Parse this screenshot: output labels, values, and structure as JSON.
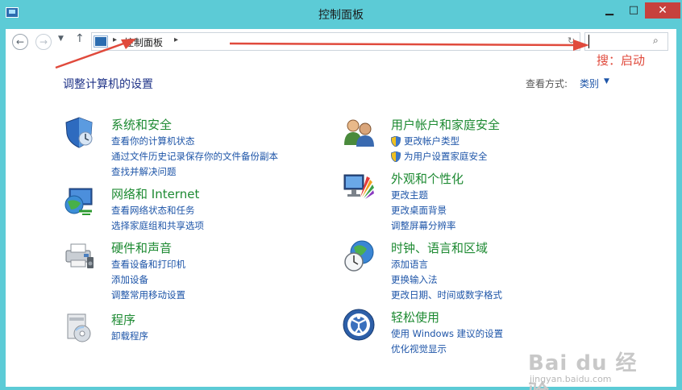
{
  "window": {
    "title": "控制面板",
    "minimize_glyph": "▁",
    "maximize_glyph": "□",
    "close_glyph": "✕"
  },
  "navbar": {
    "back_glyph": "←",
    "forward_glyph": "→",
    "dropdown_glyph": "▼",
    "up_glyph": "↑",
    "breadcrumb_sep": "▸",
    "breadcrumb": "控制面板",
    "refresh_glyph": "↻",
    "search_value": "",
    "search_glyph": "⌕"
  },
  "annotation": {
    "search_note": "搜：启动",
    "color": "#e04a3c"
  },
  "main": {
    "heading": "调整计算机的设置",
    "view_by_label": "查看方式:",
    "view_by_value": "类别",
    "view_by_caret": "▼"
  },
  "categories": [
    {
      "title": "系统和安全",
      "icon": "shield-icon",
      "links": [
        "查看你的计算机状态",
        "通过文件历史记录保存你的文件备份副本",
        "查找并解决问题"
      ]
    },
    {
      "title": "网络和 Internet",
      "icon": "network-globe-icon",
      "links": [
        "查看网络状态和任务",
        "选择家庭组和共享选项"
      ]
    },
    {
      "title": "硬件和声音",
      "icon": "printer-icon",
      "links": [
        "查看设备和打印机",
        "添加设备",
        "调整常用移动设置"
      ]
    },
    {
      "title": "程序",
      "icon": "program-disc-icon",
      "links": [
        "卸载程序"
      ]
    },
    {
      "title": "用户帐户和家庭安全",
      "icon": "users-icon",
      "links": [
        "更改帐户类型",
        "为用户设置家庭安全"
      ]
    },
    {
      "title": "外观和个性化",
      "icon": "monitor-palette-icon",
      "links": [
        "更改主题",
        "更改桌面背景",
        "调整屏幕分辨率"
      ]
    },
    {
      "title": "时钟、语言和区域",
      "icon": "clock-globe-icon",
      "links": [
        "添加语言",
        "更换输入法",
        "更改日期、时间或数字格式"
      ]
    },
    {
      "title": "轻松使用",
      "icon": "ease-of-access-icon",
      "links": [
        "使用 Windows 建议的设置",
        "优化视觉显示"
      ]
    }
  ],
  "watermark": {
    "brand": "Bai du 经验",
    "url": "jingyan.baidu.com"
  },
  "colors": {
    "title_bar": "#5ccbd6",
    "category_title": "#1d8a32",
    "link": "#1e55a8",
    "heading": "#1e3287",
    "close_button": "#c7413d"
  }
}
